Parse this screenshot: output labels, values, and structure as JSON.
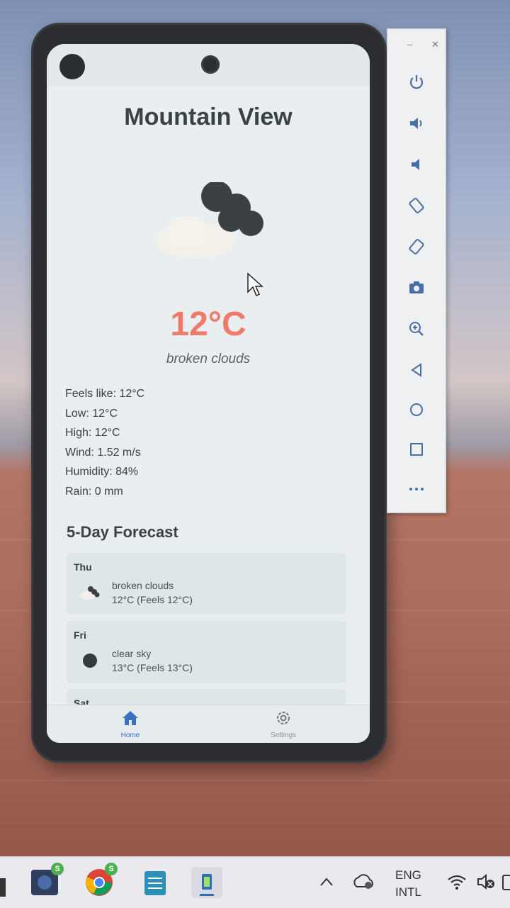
{
  "app": {
    "city": "Mountain View",
    "current": {
      "icon": "broken-clouds-icon",
      "temperature": "12°C",
      "description": "broken clouds"
    },
    "details": [
      "Feels like: 12°C",
      "Low: 12°C",
      "High: 12°C",
      "Wind: 1.52 m/s",
      "Humidity: 84%",
      "Rain: 0 mm"
    ],
    "forecast_title": "5-Day Forecast",
    "forecast": [
      {
        "day": "Thu",
        "icon": "broken-clouds-icon",
        "description": "broken clouds",
        "temp": "12°C (Feels 12°C)"
      },
      {
        "day": "Fri",
        "icon": "clear-sky-icon",
        "description": "clear sky",
        "temp": "13°C (Feels 13°C)"
      },
      {
        "day": "Sat"
      }
    ],
    "nav": [
      {
        "label": "Home",
        "icon": "home-icon",
        "active": true
      },
      {
        "label": "Settings",
        "icon": "gear-icon",
        "active": false
      }
    ]
  },
  "emulator_toolbar": {
    "window_controls": [
      "minimize-icon",
      "close-icon"
    ],
    "buttons": [
      "power-icon",
      "volume-up-icon",
      "volume-down-icon",
      "rotate-left-icon",
      "rotate-right-icon",
      "camera-icon",
      "zoom-icon",
      "back-icon",
      "home-circle-icon",
      "overview-icon",
      "more-icon"
    ]
  },
  "taskbar": {
    "apps": [
      {
        "icon": "app-icon",
        "badge": "S"
      },
      {
        "icon": "chrome-icon",
        "badge": "S"
      },
      {
        "icon": "notepad-icon"
      },
      {
        "icon": "emulator-icon"
      }
    ],
    "tray": {
      "lang_line1": "ENG",
      "lang_line2": "INTL"
    }
  },
  "colors": {
    "temperature": "#ee7b6a",
    "nav_active": "#3a6fc4",
    "screen_bg": "#e9eef1"
  }
}
